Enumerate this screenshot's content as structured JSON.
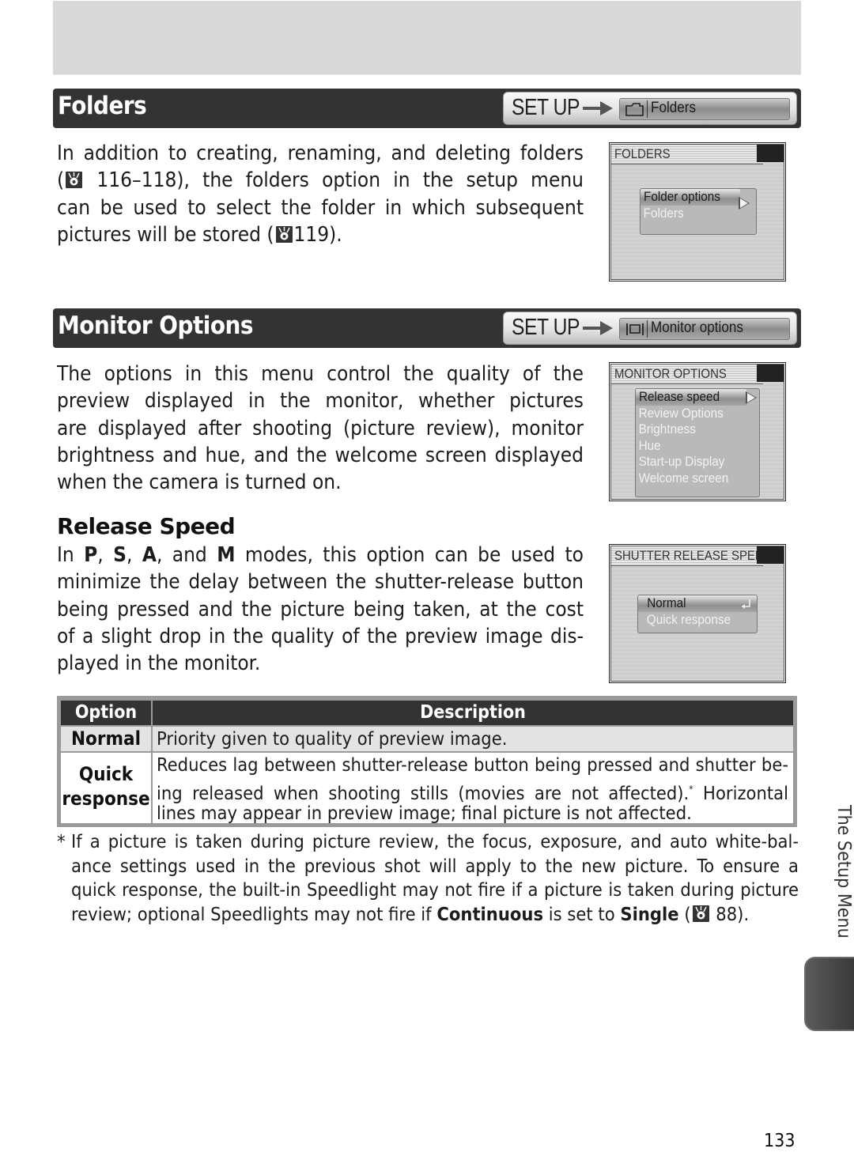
{
  "sections": {
    "folders": {
      "title": "Folders",
      "breadcrumb": {
        "menu": "SET UP",
        "item": "Folders",
        "icon": "folder-icon"
      },
      "body_lines": [
        "In addition to creating, renaming, and deleting folders",
        "116–118), the folders option in the setup menu",
        "can be used to select the folder in which subsequent",
        "pictures will be stored (",
        "119)."
      ],
      "screen": {
        "title": "FOLDERS",
        "items": [
          "Folder options",
          "Folders"
        ],
        "selected": "Folder options"
      }
    },
    "monitor_options": {
      "title": "Monitor Options",
      "breadcrumb": {
        "menu": "SET UP",
        "item": "Monitor options",
        "icon": "monitor-icon"
      },
      "body_lines": [
        "The options in this menu control the quality of the",
        "preview displayed in the monitor, whether pictures",
        "are displayed after shooting (picture review), monitor",
        "brightness and hue, and the welcome screen displayed",
        "when the camera is turned on."
      ],
      "screen": {
        "title": "MONITOR OPTIONS",
        "items": [
          "Release speed",
          "Review Options",
          "Brightness",
          "Hue",
          "Start-up Display",
          "Welcome screen"
        ],
        "selected": "Release speed"
      }
    },
    "release_speed": {
      "title": "Release Speed",
      "body_line1": {
        "a": "In ",
        "P": "P",
        "c1": ", ",
        "S": "S",
        "c2": ", ",
        "A": "A",
        "c3": ", and ",
        "M": "M",
        "rest": " modes, this option can be used to"
      },
      "body_lines": [
        "minimize the delay between the shutter-release button",
        "being pressed and the picture being taken, at the cost",
        "of a slight drop in the quality of the preview image dis-",
        "played in the monitor."
      ],
      "screen": {
        "title": "SHUTTER RELEASE SPEED",
        "items": [
          "Normal",
          "Quick response"
        ],
        "selected": "Normal"
      }
    }
  },
  "table": {
    "headers": [
      "Option",
      "Description"
    ],
    "rows": [
      {
        "option": "Normal",
        "description_lines": [
          "Priority given to quality of preview image."
        ]
      },
      {
        "option_lines": [
          "Quick",
          "response"
        ],
        "description_lines": [
          "Reduces lag between shutter-release button being pressed and shutter be-",
          "ing released when shooting stills (movies are not affected).",
          "lines may appear in preview image; final picture is not affected."
        ],
        "footnote_mark": "*",
        "after_mark": "Horizontal"
      }
    ]
  },
  "footnote": {
    "mark": "*",
    "lines": [
      "If a picture is taken during picture review, the focus, exposure, and auto white-bal-",
      "ance settings used in the previous shot will apply to the new picture.  To ensure a",
      "quick response, the built-in Speedlight may not fire if a picture is taken during picture"
    ],
    "last_line": {
      "a": "review; optional Speedlights may not fire if ",
      "b": "Continuous",
      "c": " is set to ",
      "d": "Single",
      "e": " (",
      "f": " 88)."
    }
  },
  "side_label": "The Setup Menu",
  "page_number": "133"
}
